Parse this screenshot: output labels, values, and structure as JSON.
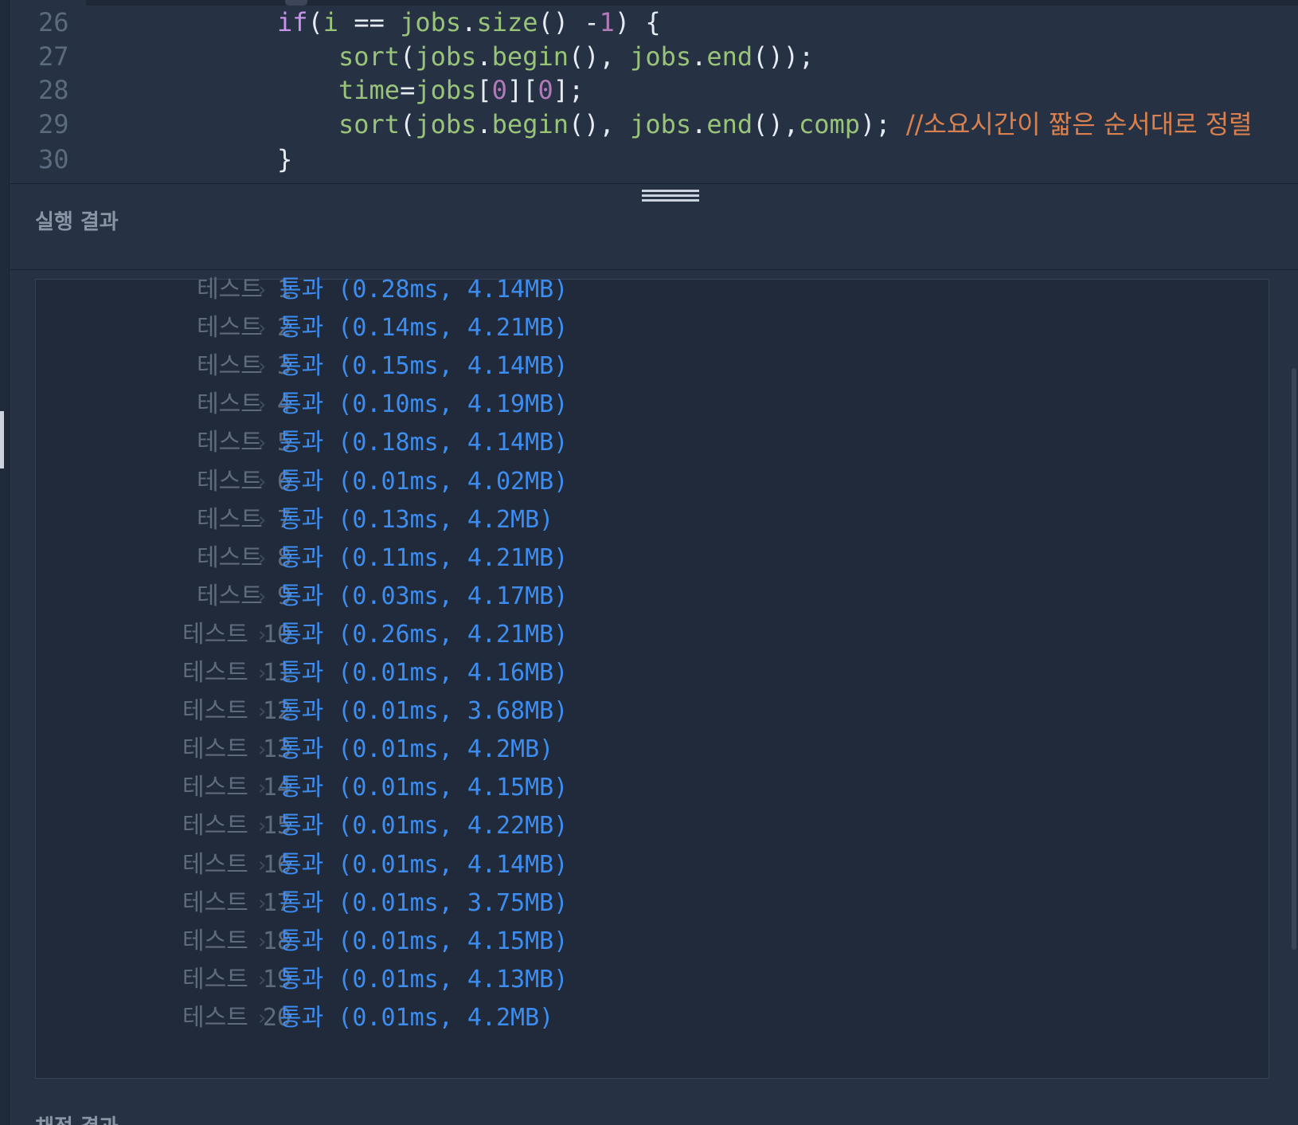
{
  "editor": {
    "lines": [
      {
        "number": "26",
        "tokens": [
          {
            "t": "if",
            "c": "kw"
          },
          {
            "t": "(",
            "c": "punct"
          },
          {
            "t": "i",
            "c": "ident"
          },
          {
            "t": " == ",
            "c": "punct"
          },
          {
            "t": "jobs",
            "c": "ident"
          },
          {
            "t": ".",
            "c": "punct"
          },
          {
            "t": "size",
            "c": "ident"
          },
          {
            "t": "() -",
            "c": "punct"
          },
          {
            "t": "1",
            "c": "num"
          },
          {
            "t": ") {",
            "c": "punct"
          }
        ],
        "indent": 0
      },
      {
        "number": "27",
        "tokens": [
          {
            "t": "sort",
            "c": "ident"
          },
          {
            "t": "(",
            "c": "punct"
          },
          {
            "t": "jobs",
            "c": "ident"
          },
          {
            "t": ".",
            "c": "punct"
          },
          {
            "t": "begin",
            "c": "ident"
          },
          {
            "t": "(), ",
            "c": "punct"
          },
          {
            "t": "jobs",
            "c": "ident"
          },
          {
            "t": ".",
            "c": "punct"
          },
          {
            "t": "end",
            "c": "ident"
          },
          {
            "t": "());",
            "c": "punct"
          }
        ],
        "indent": 4
      },
      {
        "number": "28",
        "tokens": [
          {
            "t": "time",
            "c": "ident"
          },
          {
            "t": "=",
            "c": "punct"
          },
          {
            "t": "jobs",
            "c": "ident"
          },
          {
            "t": "[",
            "c": "punct"
          },
          {
            "t": "0",
            "c": "num"
          },
          {
            "t": "][",
            "c": "punct"
          },
          {
            "t": "0",
            "c": "num"
          },
          {
            "t": "];",
            "c": "punct"
          }
        ],
        "indent": 4
      },
      {
        "number": "29",
        "tokens": [
          {
            "t": "sort",
            "c": "ident"
          },
          {
            "t": "(",
            "c": "punct"
          },
          {
            "t": "jobs",
            "c": "ident"
          },
          {
            "t": ".",
            "c": "punct"
          },
          {
            "t": "begin",
            "c": "ident"
          },
          {
            "t": "(), ",
            "c": "punct"
          },
          {
            "t": "jobs",
            "c": "ident"
          },
          {
            "t": ".",
            "c": "punct"
          },
          {
            "t": "end",
            "c": "ident"
          },
          {
            "t": "(),",
            "c": "punct"
          },
          {
            "t": "comp",
            "c": "ident"
          },
          {
            "t": "); ",
            "c": "punct"
          },
          {
            "t": "//소요시간이 짧은 순서대로 정렬",
            "c": "comment"
          }
        ],
        "indent": 4
      },
      {
        "number": "30",
        "tokens": [
          {
            "t": "}",
            "c": "punct"
          }
        ],
        "indent": 0
      }
    ]
  },
  "results": {
    "title": "실행 결과",
    "rows": [
      {
        "label": "테스트",
        "num": "1",
        "status": "통과",
        "detail": "(0.28ms, 4.14MB)"
      },
      {
        "label": "테스트",
        "num": "2",
        "status": "통과",
        "detail": "(0.14ms, 4.21MB)"
      },
      {
        "label": "테스트",
        "num": "3",
        "status": "통과",
        "detail": "(0.15ms, 4.14MB)"
      },
      {
        "label": "테스트",
        "num": "4",
        "status": "통과",
        "detail": "(0.10ms, 4.19MB)"
      },
      {
        "label": "테스트",
        "num": "5",
        "status": "통과",
        "detail": "(0.18ms, 4.14MB)"
      },
      {
        "label": "테스트",
        "num": "6",
        "status": "통과",
        "detail": "(0.01ms, 4.02MB)"
      },
      {
        "label": "테스트",
        "num": "7",
        "status": "통과",
        "detail": "(0.13ms, 4.2MB)"
      },
      {
        "label": "테스트",
        "num": "8",
        "status": "통과",
        "detail": "(0.11ms, 4.21MB)"
      },
      {
        "label": "테스트",
        "num": "9",
        "status": "통과",
        "detail": "(0.03ms, 4.17MB)"
      },
      {
        "label": "테스트",
        "num": "10",
        "status": "통과",
        "detail": "(0.26ms, 4.21MB)"
      },
      {
        "label": "테스트",
        "num": "11",
        "status": "통과",
        "detail": "(0.01ms, 4.16MB)"
      },
      {
        "label": "테스트",
        "num": "12",
        "status": "통과",
        "detail": "(0.01ms, 3.68MB)"
      },
      {
        "label": "테스트",
        "num": "13",
        "status": "통과",
        "detail": "(0.01ms, 4.2MB)"
      },
      {
        "label": "테스트",
        "num": "14",
        "status": "통과",
        "detail": "(0.01ms, 4.15MB)"
      },
      {
        "label": "테스트",
        "num": "15",
        "status": "통과",
        "detail": "(0.01ms, 4.22MB)"
      },
      {
        "label": "테스트",
        "num": "16",
        "status": "통과",
        "detail": "(0.01ms, 4.14MB)"
      },
      {
        "label": "테스트",
        "num": "17",
        "status": "통과",
        "detail": "(0.01ms, 3.75MB)"
      },
      {
        "label": "테스트",
        "num": "18",
        "status": "통과",
        "detail": "(0.01ms, 4.15MB)"
      },
      {
        "label": "테스트",
        "num": "19",
        "status": "통과",
        "detail": "(0.01ms, 4.13MB)"
      },
      {
        "label": "테스트",
        "num": "20",
        "status": "통과",
        "detail": "(0.01ms, 4.2MB)"
      }
    ]
  },
  "bottom_section": {
    "title": "채점 결과"
  },
  "icons": {
    "row_chevron": "chevron-right-icon",
    "splitter": "drag-handle-icon"
  },
  "colors": {
    "background": "#263244",
    "panel": "#202a3b",
    "pass": "#3d8df0",
    "comment": "#d9804e",
    "keyword": "#c792ea",
    "identifier": "#98c379",
    "number": "#b07ab8"
  }
}
